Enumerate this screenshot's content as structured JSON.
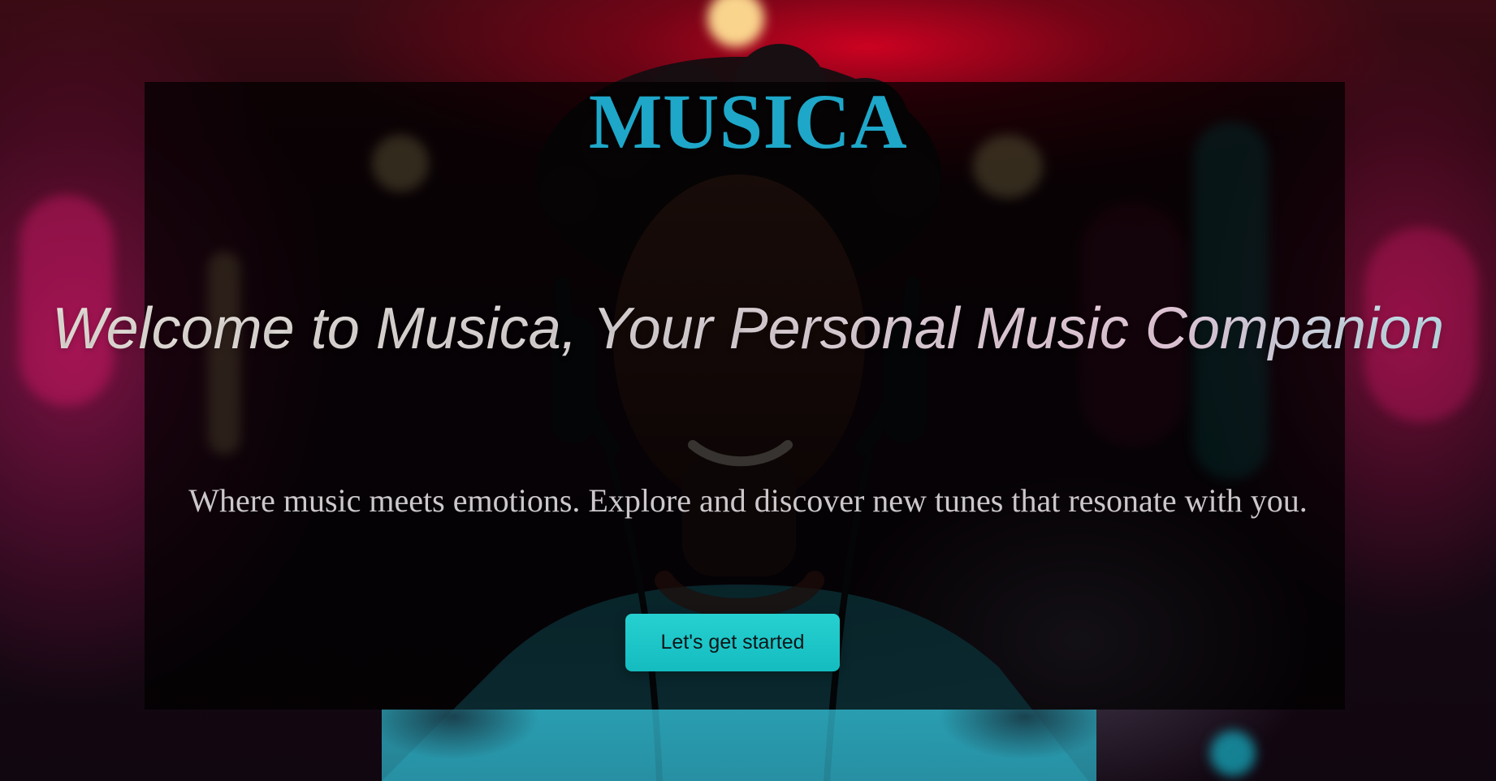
{
  "page": {
    "logo": "MUSICA",
    "hero_title": "Welcome to Musica, Your Personal Music Companion",
    "tagline": "Where music meets emotions. Explore and discover new tunes that resonate with you.",
    "cta_label": "Let's get started"
  },
  "theme": {
    "accent": "#1ea7c8",
    "button": "#1ec6c8",
    "overlay": "rgba(0, 0, 0, 0.72)",
    "hero_text": "#e9e4e8",
    "tagline_text": "#cbc7ca"
  }
}
